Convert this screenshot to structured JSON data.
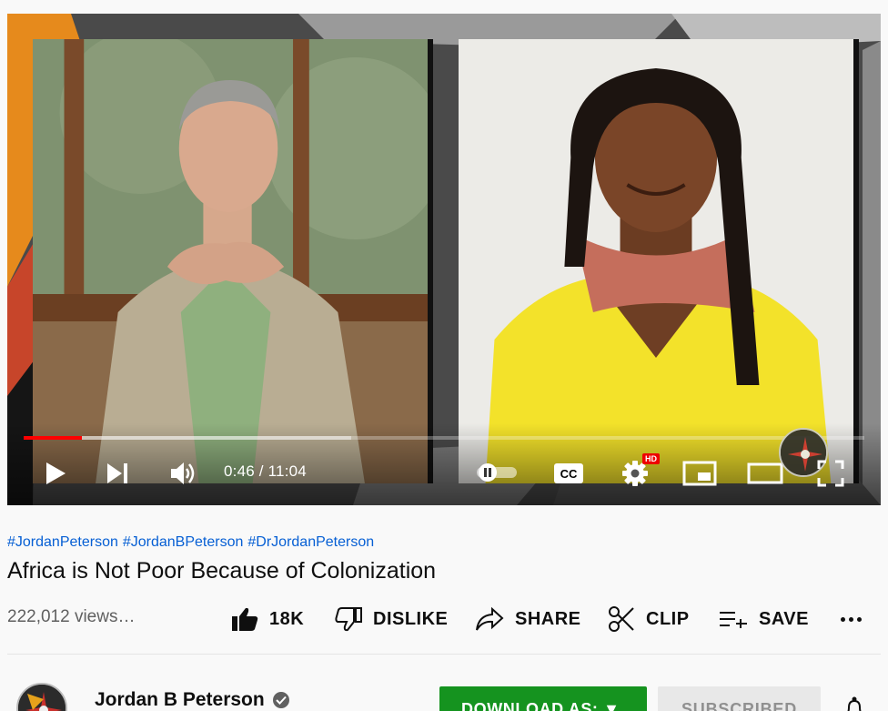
{
  "player": {
    "current_time": "0:46",
    "duration": "11:04",
    "time_display": "0:46 / 11:04",
    "progress_fraction": 0.069,
    "hd_badge": "HD",
    "cc_label": "CC",
    "accent_color": "#ff0000"
  },
  "hashtags": [
    "#JordanPeterson",
    "#JordanBPeterson",
    "#DrJordanPeterson"
  ],
  "video_title": "Africa is Not Poor Because of Colonization",
  "views": "222,012 views…",
  "actions": {
    "like": "18K",
    "dislike": "DISLIKE",
    "share": "SHARE",
    "clip": "CLIP",
    "save": "SAVE"
  },
  "channel": {
    "name": "Jordan B Peterson",
    "verified": true
  },
  "buttons": {
    "download": "DOWNLOAD AS: ▼",
    "subscribed": "SUBSCRIBED"
  },
  "colors": {
    "link": "#065fd4",
    "download_green": "#15931f",
    "muted_text": "#606060"
  },
  "icons": [
    "play-icon",
    "next-icon",
    "volume-icon",
    "autoplay-toggle-icon",
    "captions-icon",
    "settings-icon",
    "miniplayer-icon",
    "theater-icon",
    "fullscreen-icon",
    "like-icon",
    "dislike-icon",
    "share-icon",
    "clip-icon",
    "save-icon",
    "more-icon",
    "verified-icon",
    "bell-icon"
  ]
}
